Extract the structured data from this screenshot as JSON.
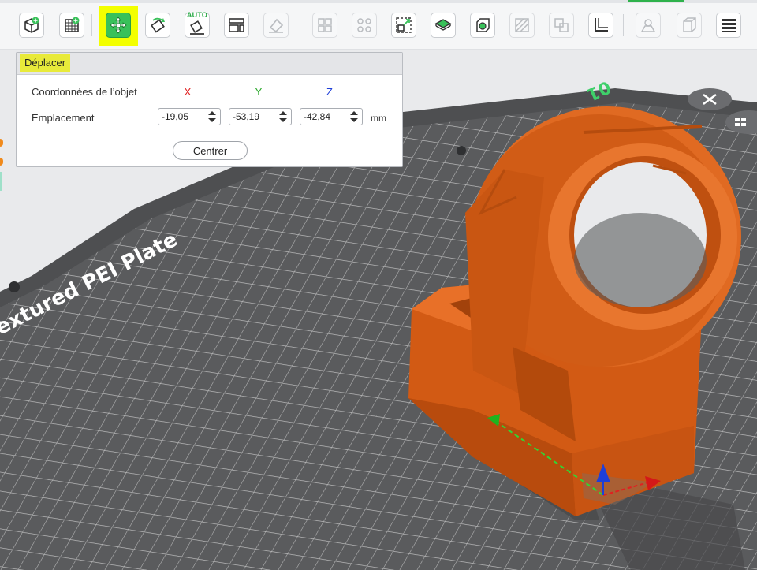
{
  "colors": {
    "accent": "#39c15a",
    "highlight": "#f3ff00",
    "model": "#e0661e",
    "bed": "#555658",
    "axis_x": "#e02020",
    "axis_y": "#2aa82a",
    "axis_z": "#1f3fd8"
  },
  "toolbar": {
    "tools": [
      {
        "name": "add-object-icon",
        "state": "normal"
      },
      {
        "name": "add-plate-icon",
        "state": "normal"
      },
      {
        "name": "move-tool-icon",
        "state": "active"
      },
      {
        "name": "rotate-tool-icon",
        "state": "normal"
      },
      {
        "name": "auto-orient-icon",
        "state": "normal",
        "badge": "AUTO"
      },
      {
        "name": "arrange-icon",
        "state": "normal"
      },
      {
        "name": "lay-on-face-icon",
        "state": "disabled"
      },
      {
        "name": "split-objects-icon",
        "state": "disabled"
      },
      {
        "name": "split-parts-icon",
        "state": "disabled"
      },
      {
        "name": "scale-tool-icon",
        "state": "normal"
      },
      {
        "name": "cut-tool-icon",
        "state": "normal"
      },
      {
        "name": "boolean-icon",
        "state": "normal"
      },
      {
        "name": "support-paint-icon",
        "state": "disabled"
      },
      {
        "name": "seam-paint-icon",
        "state": "disabled"
      },
      {
        "name": "measure-icon",
        "state": "normal"
      },
      {
        "name": "assembly-icon",
        "state": "disabled"
      },
      {
        "name": "text-emboss-icon",
        "state": "disabled"
      },
      {
        "name": "layers-icon",
        "state": "normal"
      }
    ]
  },
  "move_panel": {
    "title": "Déplacer",
    "coords_label": "Coordonnées de l’objet",
    "axis_x": "X",
    "axis_y": "Y",
    "axis_z": "Z",
    "position_label": "Emplacement",
    "x_value": "-19,05",
    "y_value": "-53,19",
    "z_value": "-42,84",
    "unit": "mm",
    "center_button": "Centrer"
  },
  "viewport": {
    "plate_label": "extured PEI Plate",
    "plate_number": "01",
    "close_icon": "close-icon",
    "menu_icon": "plate-menu-icon"
  }
}
